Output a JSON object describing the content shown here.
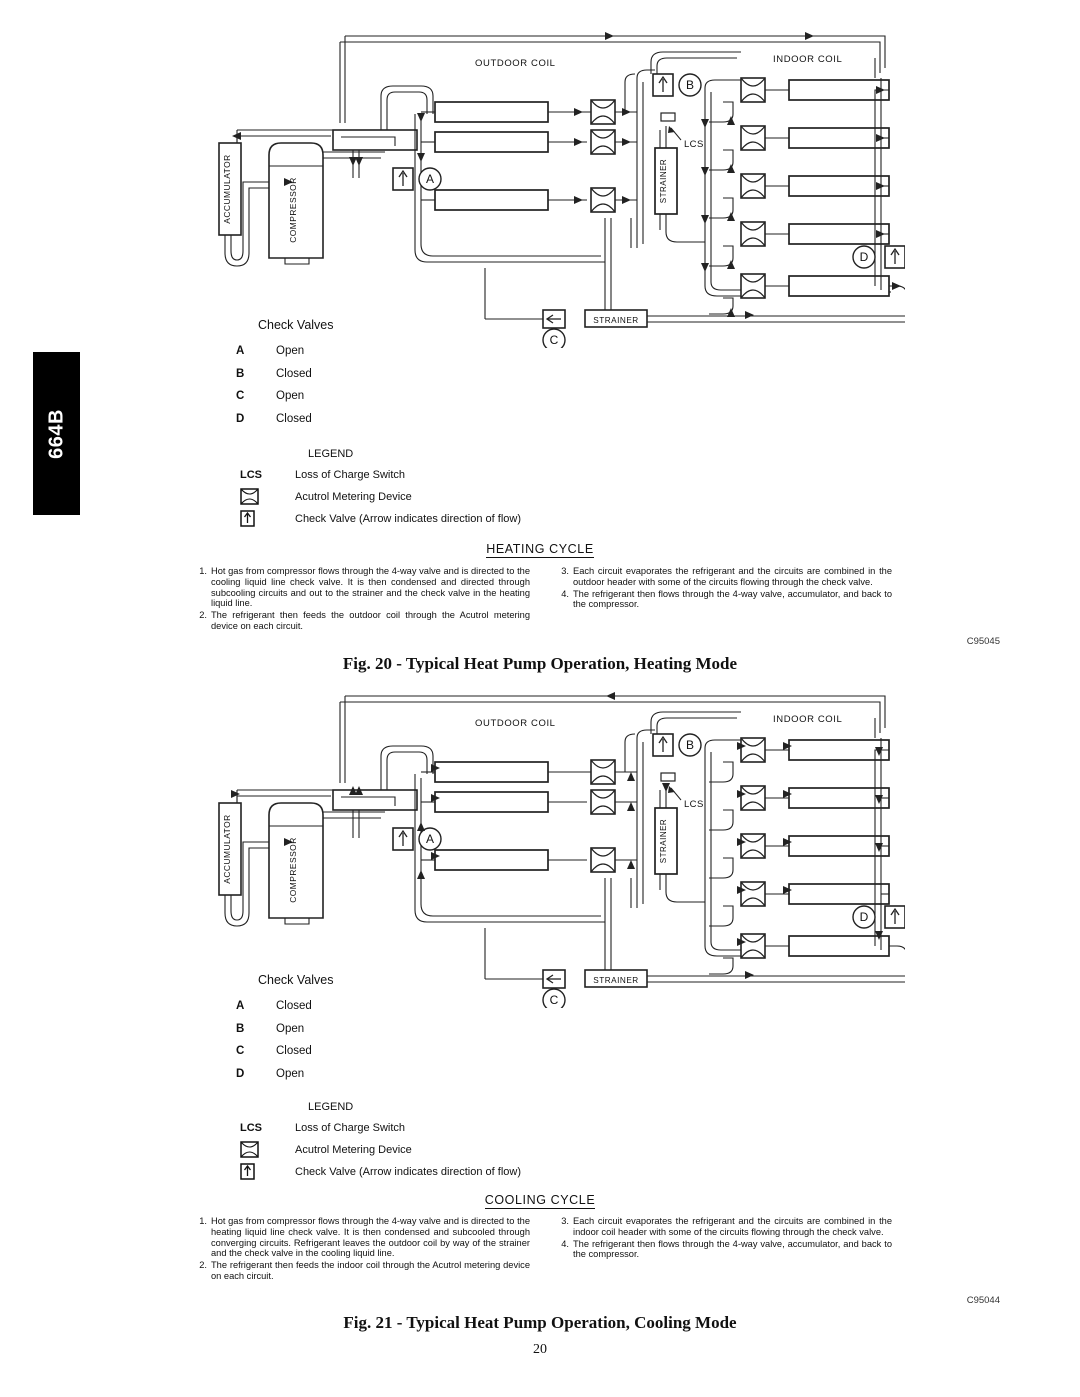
{
  "page": {
    "number": "20",
    "side_tab": "664B"
  },
  "figures": [
    {
      "id": "fig20",
      "caption": "Fig. 20 - Typical Heat Pump Operation, Heating Mode",
      "code": "C95045",
      "cycle_heading": "HEATING CYCLE",
      "diagram": {
        "outdoor_coil_label": "OUTDOOR COIL",
        "indoor_coil_label": "INDOOR COIL",
        "accumulator_label": "ACCUMULATOR",
        "compressor_label": "COMPRESSOR",
        "strainer_label": "STRAINER",
        "bottom_strainer_label": "STRAINER",
        "lcs_label": "LCS",
        "valve_a": "A",
        "valve_b": "B",
        "valve_c": "C",
        "valve_d": "D"
      },
      "check_valves": {
        "title": "Check Valves",
        "rows": [
          {
            "key": "A",
            "value": "Open"
          },
          {
            "key": "B",
            "value": "Closed"
          },
          {
            "key": "C",
            "value": "Open"
          },
          {
            "key": "D",
            "value": "Closed"
          }
        ]
      },
      "legend": {
        "title": "LEGEND",
        "lcs_key": "LCS",
        "lcs_text": "Loss of Charge Switch",
        "acutrol_text": "Acutrol    Metering Device",
        "check_valve_text": "Check Valve (Arrow indicates direction of flow)"
      },
      "steps_left": [
        {
          "num": "1.",
          "text": "Hot gas from compressor flows through the 4-way valve and is directed to the cooling liquid line check valve. It is then condensed and directed through subcooling circuits and out to the strainer and the check valve in the heating liquid line."
        },
        {
          "num": "2.",
          "text": "The refrigerant then feeds the outdoor coil through the Acutrol metering device on each circuit."
        }
      ],
      "steps_right": [
        {
          "num": "3.",
          "text": "Each circuit evaporates the refrigerant and the circuits are combined in the outdoor header with some of the circuits flowing through the check valve."
        },
        {
          "num": "4.",
          "text": "The refrigerant then flows through the 4-way valve, accumulator, and back to the compressor."
        }
      ]
    },
    {
      "id": "fig21",
      "caption": "Fig. 21 - Typical Heat Pump Operation, Cooling Mode",
      "code": "C95044",
      "cycle_heading": "COOLING CYCLE",
      "diagram": {
        "outdoor_coil_label": "OUTDOOR COIL",
        "indoor_coil_label": "INDOOR COIL",
        "accumulator_label": "ACCUMULATOR",
        "compressor_label": "COMPRESSOR",
        "strainer_label": "STRAINER",
        "bottom_strainer_label": "STRAINER",
        "lcs_label": "LCS",
        "valve_a": "A",
        "valve_b": "B",
        "valve_c": "C",
        "valve_d": "D"
      },
      "check_valves": {
        "title": "Check Valves",
        "rows": [
          {
            "key": "A",
            "value": "Closed"
          },
          {
            "key": "B",
            "value": "Open"
          },
          {
            "key": "C",
            "value": "Closed"
          },
          {
            "key": "D",
            "value": "Open"
          }
        ]
      },
      "legend": {
        "title": "LEGEND",
        "lcs_key": "LCS",
        "lcs_text": "Loss of Charge Switch",
        "acutrol_text": "Acutrol    Metering Device",
        "check_valve_text": "Check Valve (Arrow indicates direction of flow)"
      },
      "steps_left": [
        {
          "num": "1.",
          "text": "Hot gas from compressor flows through the 4-way valve and is directed to the heating liquid line check valve. It is then condensed and subcooled through converging circuits. Refrigerant leaves the outdoor coil by way of the strainer and the check valve in the cooling liquid line."
        },
        {
          "num": "2.",
          "text": "The refrigerant then feeds the indoor coil through the Acutrol metering device on each circuit."
        }
      ],
      "steps_right": [
        {
          "num": "3.",
          "text": "Each circuit evaporates the refrigerant and the circuits are combined in the indoor coil header with some of the circuits flowing through the check valve."
        },
        {
          "num": "4.",
          "text": "The refrigerant then flows through the 4-way valve, accumulator, and back to the compressor."
        }
      ]
    }
  ]
}
